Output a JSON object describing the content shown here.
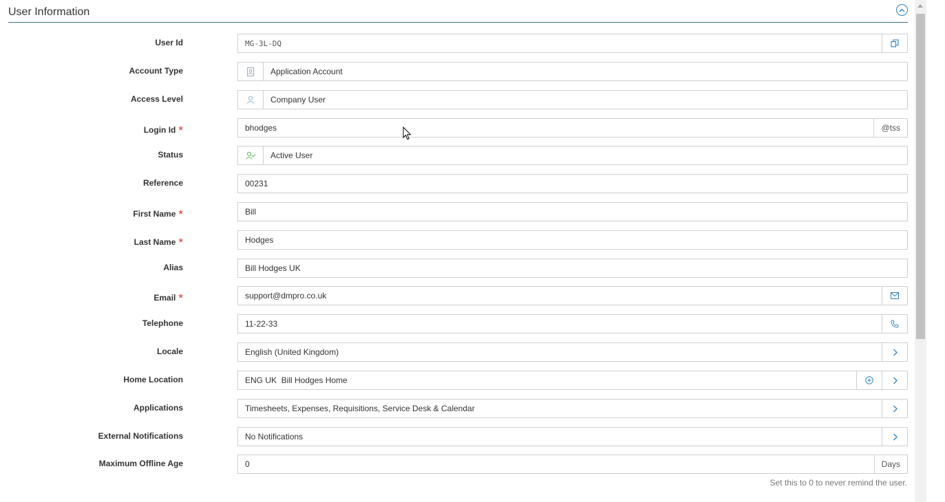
{
  "section": {
    "title": "User Information"
  },
  "fields": {
    "user_id": {
      "label": "User Id",
      "value": "MG-3L-DQ"
    },
    "account_type": {
      "label": "Account Type",
      "value": "Application Account"
    },
    "access_level": {
      "label": "Access Level",
      "value": "Company User"
    },
    "login_id": {
      "label": "Login Id",
      "required": "*",
      "value": "bhodges",
      "suffix": "@tss"
    },
    "status": {
      "label": "Status",
      "value": "Active User"
    },
    "reference": {
      "label": "Reference",
      "value": "00231"
    },
    "first_name": {
      "label": "First Name",
      "required": "*",
      "value": "Bill"
    },
    "last_name": {
      "label": "Last Name",
      "required": "*",
      "value": "Hodges"
    },
    "alias": {
      "label": "Alias",
      "value": "Bill Hodges UK"
    },
    "email": {
      "label": "Email",
      "required": "*",
      "value": "support@dmpro.co.uk"
    },
    "telephone": {
      "label": "Telephone",
      "value": "11-22-33"
    },
    "locale": {
      "label": "Locale",
      "value": "English (United Kingdom)"
    },
    "home_location": {
      "label": "Home Location",
      "value": "ENG UK  Bill Hodges Home"
    },
    "applications": {
      "label": "Applications",
      "value": "Timesheets, Expenses, Requisitions, Service Desk & Calendar"
    },
    "external_notifications": {
      "label": "External Notifications",
      "value": "No Notifications"
    },
    "max_offline_age": {
      "label": "Maximum Offline Age",
      "value": "0",
      "suffix": "Days"
    }
  },
  "hint": "Set this to 0 to never remind the user.",
  "icons": {
    "copy": "copy-icon",
    "badge": "id-badge-icon",
    "user": "user-icon",
    "user_check": "user-check-icon",
    "mail": "mail-icon",
    "phone": "phone-icon",
    "chevron": "chevron-right-icon",
    "add": "plus-circle-icon",
    "collapse": "chevron-up-circle-icon"
  },
  "colors": {
    "accent": "#2a7fc1",
    "required": "#d9302c",
    "status_active": "#5cb85c",
    "header_rule": "#3b6f8f"
  }
}
